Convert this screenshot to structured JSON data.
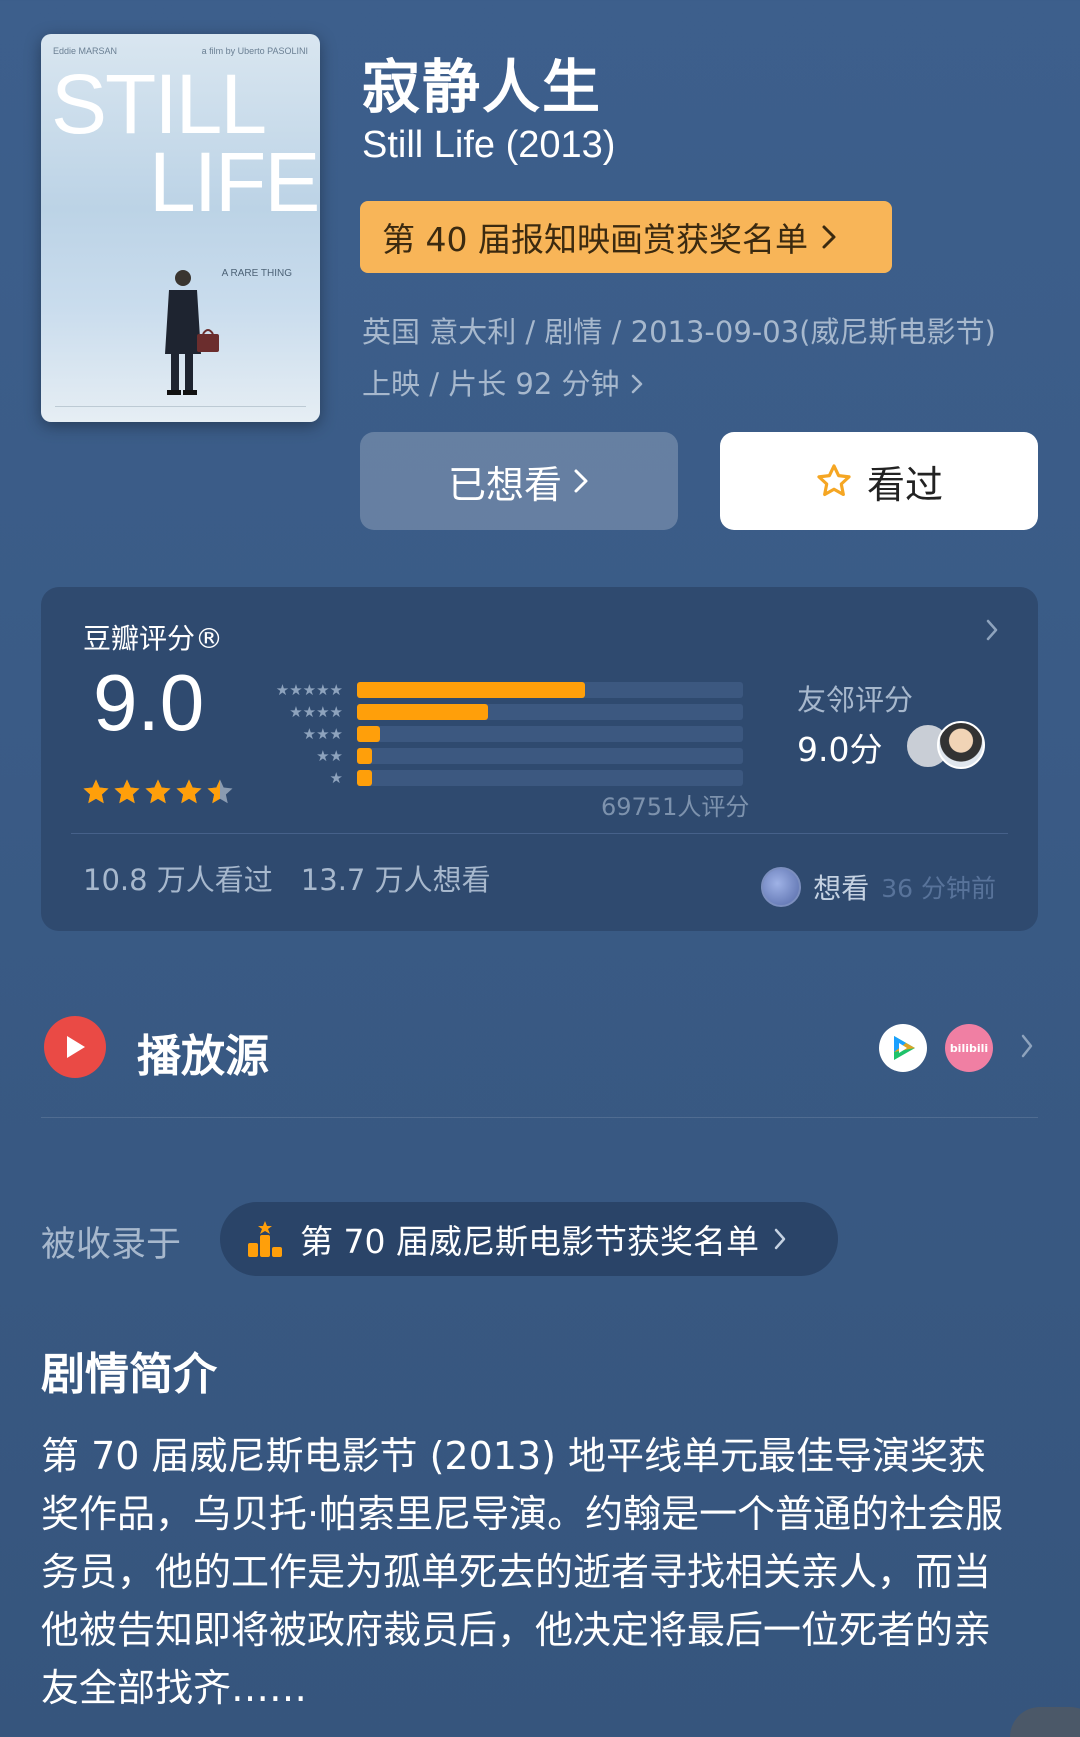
{
  "movie": {
    "title_cn": "寂静人生",
    "title_en": "Still Life (2013)",
    "award_button": "第 40 届报知映画赏获奖名单",
    "meta_line1": "英国 意大利 / 剧情 / 2013-09-03(威尼斯电影节)",
    "meta_line2": "上映 / 片长 92 分钟"
  },
  "poster": {
    "credit_left": "Eddie MARSAN",
    "credit_right": "a film by Uberto PASOLINI",
    "word1": "STILL",
    "word2": "LIFE",
    "tagline": "A RARE THING"
  },
  "actions": {
    "want_label": "已想看",
    "seen_label": "看过"
  },
  "rating": {
    "label": "豆瓣评分®",
    "score": "9.0",
    "stars_value": 4.5,
    "distribution": [
      {
        "stars": "★★★★★",
        "percent": 59
      },
      {
        "stars": "★★★★",
        "percent": 34
      },
      {
        "stars": "★★★",
        "percent": 6
      },
      {
        "stars": "★★",
        "percent": 4
      },
      {
        "stars": "★",
        "percent": 4
      }
    ],
    "count": "69751人评分",
    "friend_label": "友邻评分",
    "friend_score": "9.0分",
    "watched": "10.8 万人看过",
    "want": "13.7 万人想看",
    "activity_text": "想看",
    "activity_time": "36 分钟前",
    "bar_color": "#ff9f0a"
  },
  "play": {
    "label": "播放源",
    "source2_text": "bilibili"
  },
  "collected": {
    "label": "被收录于",
    "list_name": "第 70 届威尼斯电影节获奖名单"
  },
  "synopsis": {
    "heading": "剧情简介",
    "text": "第 70 届威尼斯电影节 (2013) 地平线单元最佳导演奖获奖作品，乌贝托·帕索里尼导演。约翰是一个普通的社会服务员，他的工作是为孤单死去的逝者寻找相关亲人，而当他被告知即将被政府裁员后，他决定将最后一位死者的亲友全部找齐……"
  }
}
